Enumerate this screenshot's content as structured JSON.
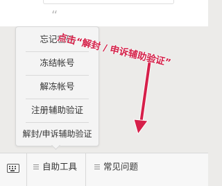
{
  "annotation": {
    "text": "点击“解封 / 申诉辅助验证”"
  },
  "menu": {
    "items": [
      {
        "label": "忘记密码"
      },
      {
        "label": "冻结帐号"
      },
      {
        "label": "解冻帐号"
      },
      {
        "label": "注册辅助验证"
      },
      {
        "label": "解封/申诉辅助验证"
      }
    ]
  },
  "bottom_bar": {
    "keyboard_icon": "keyboard-icon",
    "tabs": [
      {
        "label": "自助工具",
        "icon": "menu-lines-icon"
      },
      {
        "label": "常见问题",
        "icon": "menu-lines-icon"
      }
    ]
  },
  "colors": {
    "annotation": "#d42149",
    "arrow": "#d6204a",
    "background": "#ecebe9"
  }
}
